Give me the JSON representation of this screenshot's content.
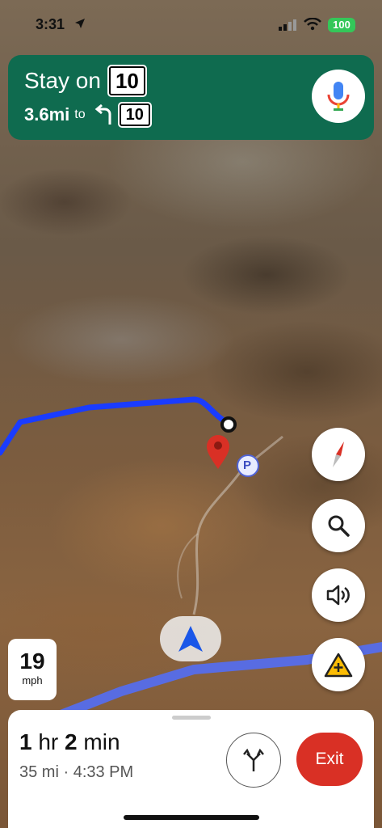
{
  "status_bar": {
    "time": "3:31",
    "battery": "100"
  },
  "banner": {
    "instruction": "Stay on",
    "route_number": "10",
    "distance": "3.6mi",
    "to_word": "to",
    "next_route_number": "10",
    "next_turn_icon": "turn-left-icon"
  },
  "map": {
    "parking_label": "P",
    "route_color": "#1a3cff",
    "destination_pin_color": "#d93025"
  },
  "speed": {
    "value": "19",
    "unit": "mph"
  },
  "controls": [
    "compass-icon",
    "search-icon",
    "volume-icon",
    "report-incident-icon"
  ],
  "trip": {
    "duration_hr": "1",
    "hr_label": "hr",
    "duration_min": "2",
    "min_label": "min",
    "distance": "35 mi",
    "separator": "·",
    "arrival": "4:33 PM",
    "exit_label": "Exit"
  },
  "colors": {
    "banner_bg": "#0f6b4f",
    "exit_bg": "#d93025",
    "battery_bg": "#34c759"
  }
}
